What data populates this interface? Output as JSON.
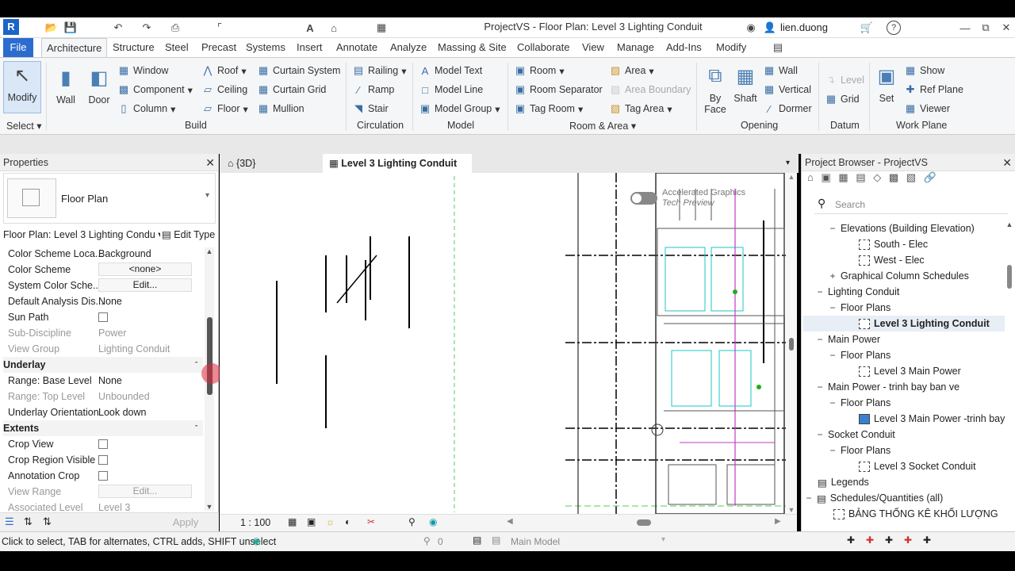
{
  "window": {
    "title": "ProjectVS - Floor Plan: Level 3 Lighting Conduit",
    "user": "lien.duong",
    "app_letter": "R"
  },
  "menu": {
    "tabs": [
      "File",
      "Architecture",
      "Structure",
      "Steel",
      "Precast",
      "Systems",
      "Insert",
      "Annotate",
      "Analyze",
      "Massing & Site",
      "Collaborate",
      "View",
      "Manage",
      "Add-Ins",
      "Modify"
    ]
  },
  "ribbon": {
    "modify": "Modify",
    "select": "Select",
    "wall": "Wall",
    "door": "Door",
    "window": "Window",
    "component": "Component",
    "column": "Column",
    "roof": "Roof",
    "ceiling": "Ceiling",
    "floor": "Floor",
    "curtain_system": "Curtain System",
    "curtain_grid": "Curtain Grid",
    "mullion": "Mullion",
    "build": "Build",
    "railing": "Railing",
    "ramp": "Ramp",
    "stair": "Stair",
    "circulation": "Circulation",
    "model_text": "Model Text",
    "model_line": "Model Line",
    "model_group": "Model Group",
    "model": "Model",
    "room": "Room",
    "room_separator": "Room Separator",
    "tag_room": "Tag Room",
    "area": "Area",
    "area_boundary": "Area Boundary",
    "tag_area": "Tag Area",
    "room_area": "Room & Area",
    "by": "By",
    "face": "Face",
    "shaft": "Shaft",
    "wall2": "Wall",
    "vertical": "Vertical",
    "dormer": "Dormer",
    "opening": "Opening",
    "level": "Level",
    "grid": "Grid",
    "datum": "Datum",
    "set": "Set",
    "show": "Show",
    "ref_plane": "Ref Plane",
    "viewer": "Viewer",
    "work_plane": "Work Plane"
  },
  "properties": {
    "title": "Properties",
    "type": "Floor Plan",
    "selector": "Floor Plan: Level 3 Lighting Condu",
    "edit_type": "Edit Type",
    "rows": [
      {
        "k": "Color Scheme Loca...",
        "v": "Background"
      },
      {
        "k": "Color Scheme",
        "v": "<none>"
      },
      {
        "k": "System Color Sche...",
        "v": "Edit..."
      },
      {
        "k": "Default Analysis Dis...",
        "v": "None"
      },
      {
        "k": "Sun Path",
        "v": ""
      },
      {
        "k": "Sub-Discipline",
        "v": "Power"
      },
      {
        "k": "View Group",
        "v": "Lighting Conduit"
      },
      {
        "k": "Underlay",
        "v": ""
      },
      {
        "k": "Range: Base Level",
        "v": "None"
      },
      {
        "k": "Range: Top Level",
        "v": "Unbounded"
      },
      {
        "k": "Underlay Orientation",
        "v": "Look down"
      },
      {
        "k": "Extents",
        "v": ""
      },
      {
        "k": "Crop View",
        "v": ""
      },
      {
        "k": "Crop Region Visible",
        "v": ""
      },
      {
        "k": "Annotation Crop",
        "v": ""
      },
      {
        "k": "View Range",
        "v": "Edit..."
      },
      {
        "k": "Associated Level",
        "v": "Level 3"
      }
    ],
    "apply": "Apply"
  },
  "view_tabs": {
    "tab1": "{3D}",
    "tab2": "Level 3 Lighting Conduit"
  },
  "canvas": {
    "accel1": "Accelerated Graphics",
    "accel2": "Tech Preview"
  },
  "view_control": {
    "scale": "1 : 100"
  },
  "browser": {
    "title": "Project Browser - ProjectVS",
    "search": "Search",
    "nodes": [
      "Elevations (Building Elevation)",
      "South - Elec",
      "West - Elec",
      "Graphical Column Schedules",
      "Lighting Conduit",
      "Floor Plans",
      "Level 3 Lighting Conduit",
      "Main Power",
      "Floor Plans",
      "Level 3 Main Power",
      "Main Power - trinh bay ban ve",
      "Floor Plans",
      "Level 3 Main Power -trinh bay",
      "Socket Conduit",
      "Floor Plans",
      "Level 3 Socket Conduit",
      "Legends",
      "Schedules/Quantities (all)",
      "BẢNG THỐNG KÊ KHỐI LƯỢNG"
    ]
  },
  "status": {
    "hint": "Click to select, TAB for alternates, CTRL adds, SHIFT unselect",
    "count": "0",
    "model": "Main Model"
  }
}
